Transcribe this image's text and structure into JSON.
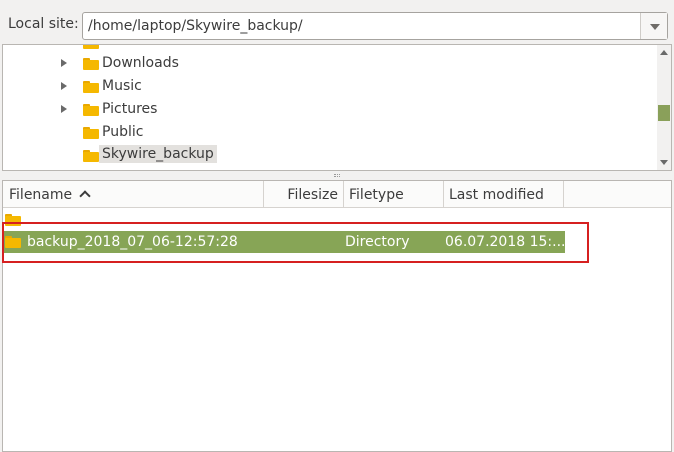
{
  "local_site": {
    "label": "Local site:",
    "path": "/home/laptop/Skywire_backup/"
  },
  "tree": {
    "items": [
      {
        "label": "Downloads",
        "expandable": true
      },
      {
        "label": "Music",
        "expandable": true
      },
      {
        "label": "Pictures",
        "expandable": true
      },
      {
        "label": "Public",
        "expandable": false
      },
      {
        "label": "Skywire_backup",
        "expandable": false,
        "selected": true
      }
    ]
  },
  "file_list": {
    "columns": {
      "filename": "Filename",
      "filesize": "Filesize",
      "filetype": "Filetype",
      "last_modified": "Last modified"
    },
    "sort_column": "filename",
    "sort_direction": "ascending",
    "parent_entry": "..",
    "rows": [
      {
        "filename": "backup_2018_07_06-12:57:28",
        "filesize": "",
        "filetype": "Directory",
        "last_modified": "06.07.2018 15:..."
      }
    ]
  },
  "colors": {
    "selection": "#87a556",
    "folder": "#f5b800",
    "annotation_box": "#d62020"
  }
}
